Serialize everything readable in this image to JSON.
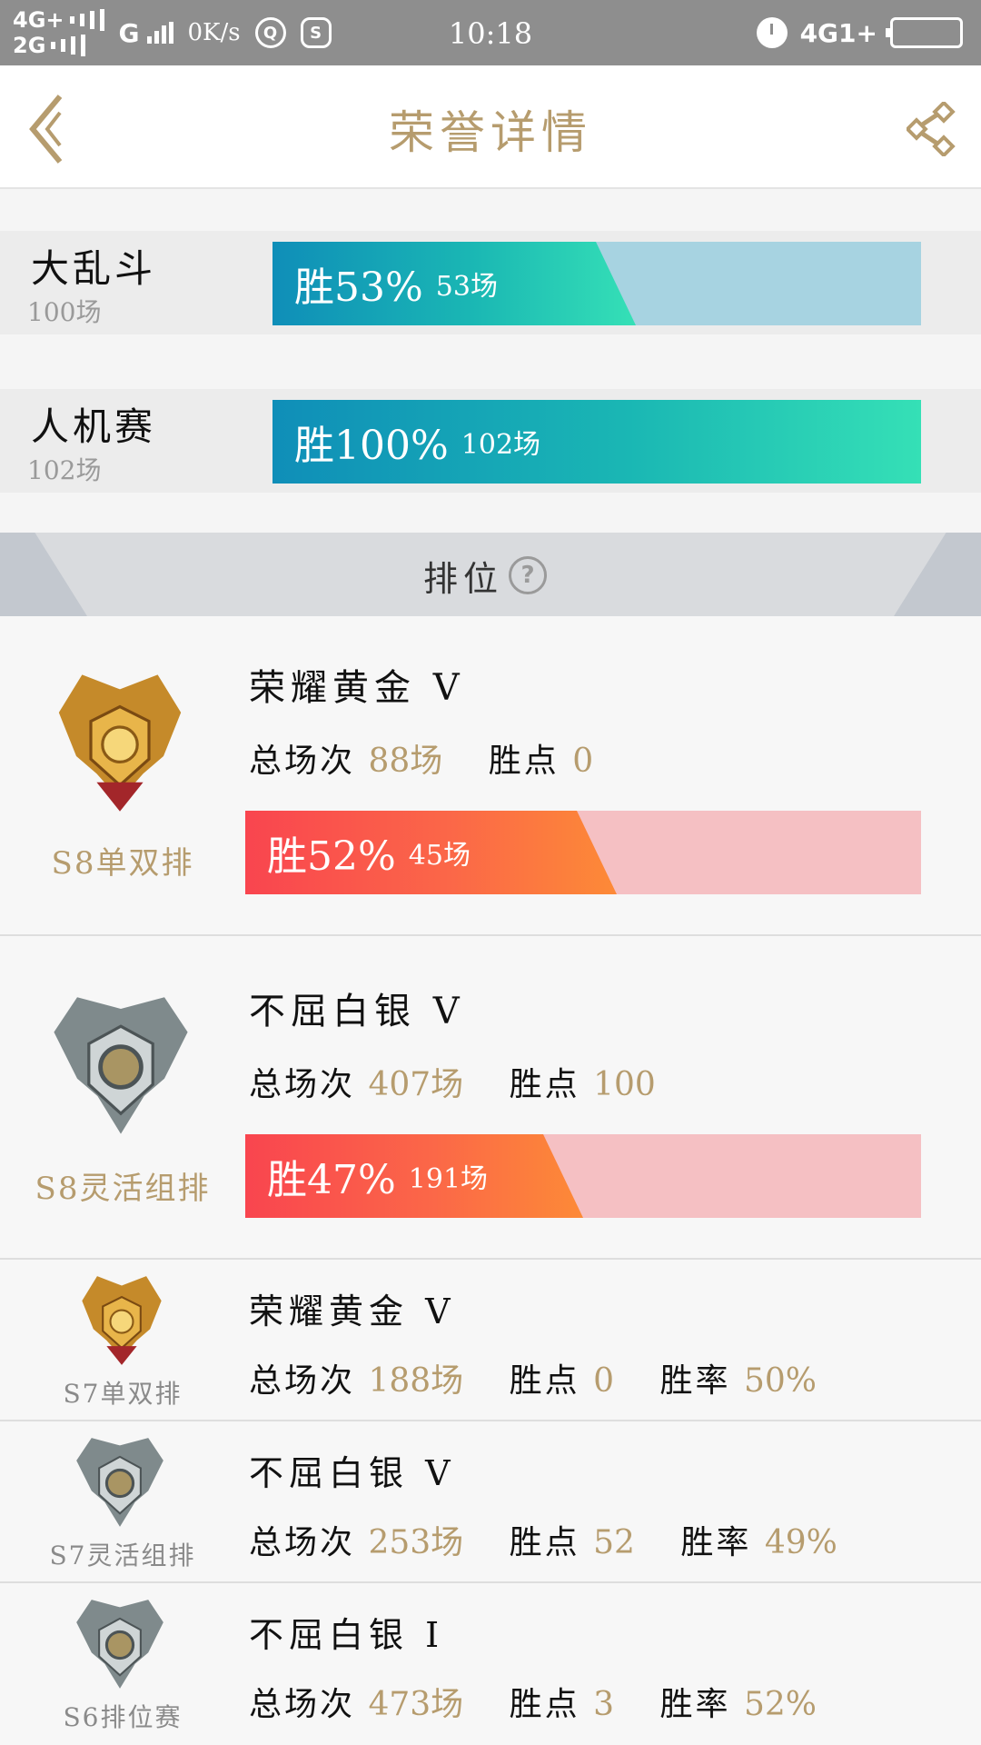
{
  "status_bar": {
    "sim1": "4G+",
    "sim2": "2G",
    "g": "G",
    "speed": "0K/s",
    "time": "10:18",
    "network_right": "4G1+"
  },
  "header": {
    "title": "荣誉详情"
  },
  "modes": [
    {
      "name": "大乱斗",
      "count": "100场",
      "win_label": "胜53%",
      "games": "53场",
      "win_rate": 0.53
    },
    {
      "name": "人机赛",
      "count": "102场",
      "win_label": "胜100%",
      "games": "102场",
      "win_rate": 1.0
    }
  ],
  "ranked": {
    "title": "排位",
    "help_icon": "?",
    "total_label": "总场次",
    "points_label": "胜点",
    "rate_label": "胜率",
    "current": [
      {
        "season": "S8单双排",
        "tier": "荣耀黄金 V",
        "total": "88场",
        "points": "0",
        "win_label": "胜52%",
        "games": "45场",
        "win_rate": 0.52,
        "badge": "gold-badge-icon"
      },
      {
        "season": "S8灵活组排",
        "tier": "不屈白银 V",
        "total": "407场",
        "points": "100",
        "win_label": "胜47%",
        "games": "191场",
        "win_rate": 0.47,
        "badge": "silver-badge-icon"
      }
    ],
    "history": [
      {
        "season": "S7单双排",
        "tier": "荣耀黄金 V",
        "total": "188场",
        "points": "0",
        "rate": "50%",
        "badge": "gold-badge-icon"
      },
      {
        "season": "S7灵活组排",
        "tier": "不屈白银 V",
        "total": "253场",
        "points": "52",
        "rate": "49%",
        "badge": "silver-badge-icon"
      },
      {
        "season": "S6排位赛",
        "tier": "不屈白银 I",
        "total": "473场",
        "points": "3",
        "rate": "52%",
        "badge": "silver-badge-icon"
      }
    ]
  },
  "colors": {
    "accent_gold": "#b69c6e",
    "win_blue": "#0f8eb8",
    "win_red": "#f9454f"
  }
}
